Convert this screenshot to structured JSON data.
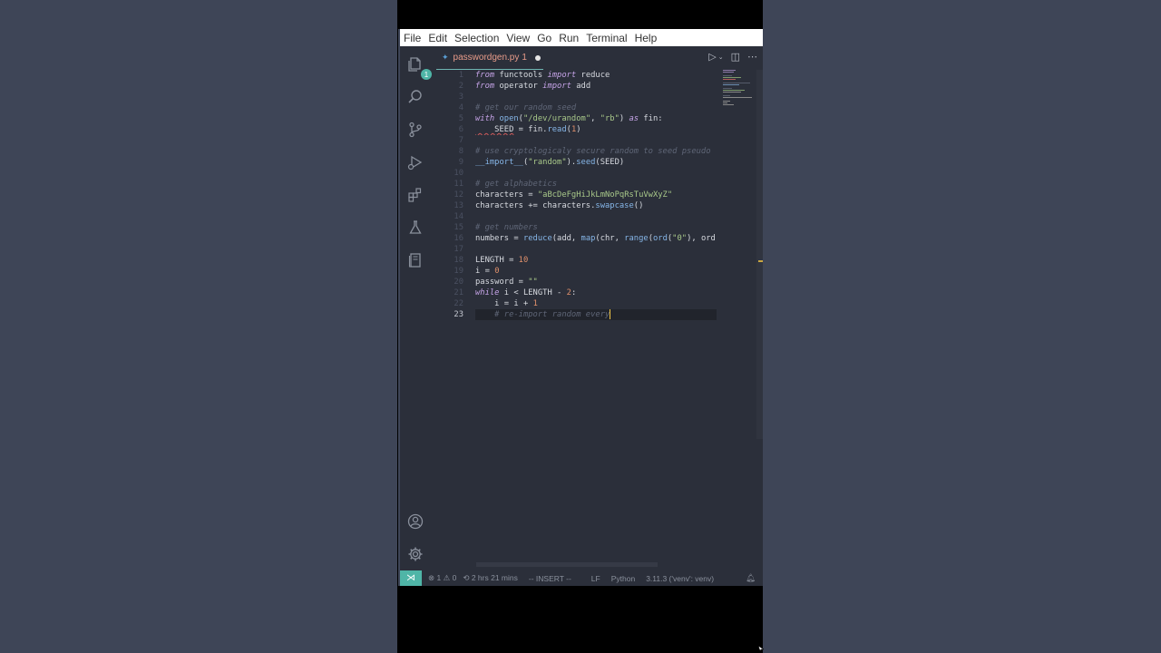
{
  "menu": [
    "File",
    "Edit",
    "Selection",
    "View",
    "Go",
    "Run",
    "Terminal",
    "Help"
  ],
  "tab": {
    "filename": "passwordgen.py",
    "problems": "1"
  },
  "activity": {
    "explorer_badge": "1"
  },
  "code_lines": [
    {
      "num": "1",
      "tokens": [
        [
          "k",
          "from"
        ],
        [
          "v",
          " functools "
        ],
        [
          "k",
          "import"
        ],
        [
          "v",
          " reduce"
        ]
      ]
    },
    {
      "num": "2",
      "tokens": [
        [
          "k",
          "from"
        ],
        [
          "v",
          " operator "
        ],
        [
          "k",
          "import"
        ],
        [
          "v",
          " add"
        ]
      ]
    },
    {
      "num": "3",
      "tokens": []
    },
    {
      "num": "4",
      "tokens": [
        [
          "c",
          "# get our random seed"
        ]
      ]
    },
    {
      "num": "5",
      "tokens": [
        [
          "k",
          "with"
        ],
        [
          "v",
          " "
        ],
        [
          "f",
          "open"
        ],
        [
          "o",
          "("
        ],
        [
          "s",
          "\"/dev/urandom\""
        ],
        [
          "o",
          ", "
        ],
        [
          "s",
          "\"rb\""
        ],
        [
          "o",
          ") "
        ],
        [
          "k",
          "as"
        ],
        [
          "v",
          " fin:"
        ]
      ]
    },
    {
      "num": "6",
      "tokens": [
        [
          "squig",
          "    SEED"
        ],
        [
          "o",
          " = fin."
        ],
        [
          "f",
          "read"
        ],
        [
          "o",
          "("
        ],
        [
          "n",
          "1"
        ],
        [
          "o",
          ")"
        ]
      ]
    },
    {
      "num": "7",
      "tokens": []
    },
    {
      "num": "8",
      "tokens": [
        [
          "c",
          "# use cryptologicaly secure random to seed pseudo"
        ]
      ]
    },
    {
      "num": "9",
      "tokens": [
        [
          "f",
          "__import__"
        ],
        [
          "o",
          "("
        ],
        [
          "s",
          "\"random\""
        ],
        [
          "o",
          ")."
        ],
        [
          "f",
          "seed"
        ],
        [
          "o",
          "(SEED)"
        ]
      ]
    },
    {
      "num": "10",
      "tokens": []
    },
    {
      "num": "11",
      "tokens": [
        [
          "c",
          "# get alphabetics"
        ]
      ]
    },
    {
      "num": "12",
      "tokens": [
        [
          "v",
          "characters = "
        ],
        [
          "s",
          "\"aBcDeFgHiJkLmNoPqRsTuVwXyZ\""
        ]
      ]
    },
    {
      "num": "13",
      "tokens": [
        [
          "v",
          "characters += characters."
        ],
        [
          "f",
          "swapcase"
        ],
        [
          "o",
          "()"
        ]
      ]
    },
    {
      "num": "14",
      "tokens": []
    },
    {
      "num": "15",
      "tokens": [
        [
          "c",
          "# get numbers"
        ]
      ]
    },
    {
      "num": "16",
      "tokens": [
        [
          "v",
          "numbers = "
        ],
        [
          "f",
          "reduce"
        ],
        [
          "o",
          "(add, "
        ],
        [
          "f",
          "map"
        ],
        [
          "o",
          "(chr, "
        ],
        [
          "f",
          "range"
        ],
        [
          "o",
          "("
        ],
        [
          "f",
          "ord"
        ],
        [
          "o",
          "("
        ],
        [
          "s",
          "\"0\""
        ],
        [
          "o",
          "), ord"
        ]
      ]
    },
    {
      "num": "17",
      "tokens": []
    },
    {
      "num": "18",
      "tokens": [
        [
          "v",
          "LENGTH = "
        ],
        [
          "n",
          "10"
        ]
      ]
    },
    {
      "num": "19",
      "tokens": [
        [
          "v",
          "i = "
        ],
        [
          "n",
          "0"
        ]
      ]
    },
    {
      "num": "20",
      "tokens": [
        [
          "v",
          "password = "
        ],
        [
          "s",
          "\"\""
        ]
      ]
    },
    {
      "num": "21",
      "tokens": [
        [
          "k",
          "while"
        ],
        [
          "v",
          " i < LENGTH - "
        ],
        [
          "n",
          "2"
        ],
        [
          "o",
          ":"
        ]
      ]
    },
    {
      "num": "22",
      "tokens": [
        [
          "v",
          "    i = i + "
        ],
        [
          "n",
          "1"
        ]
      ]
    },
    {
      "num": "23",
      "tokens": [
        [
          "c",
          "    # re-import random every"
        ]
      ]
    }
  ],
  "current_line": "23",
  "status": {
    "errors": "1",
    "warnings": "0",
    "time": "2 hrs 21 mins",
    "mode": "-- INSERT --",
    "eol": "LF",
    "language": "Python",
    "interpreter": "3.11.3 ('venv': venv)"
  },
  "colors": {
    "accent": "#4fb5a7",
    "background": "#2b2f3a",
    "desktop": "#3e4557"
  }
}
